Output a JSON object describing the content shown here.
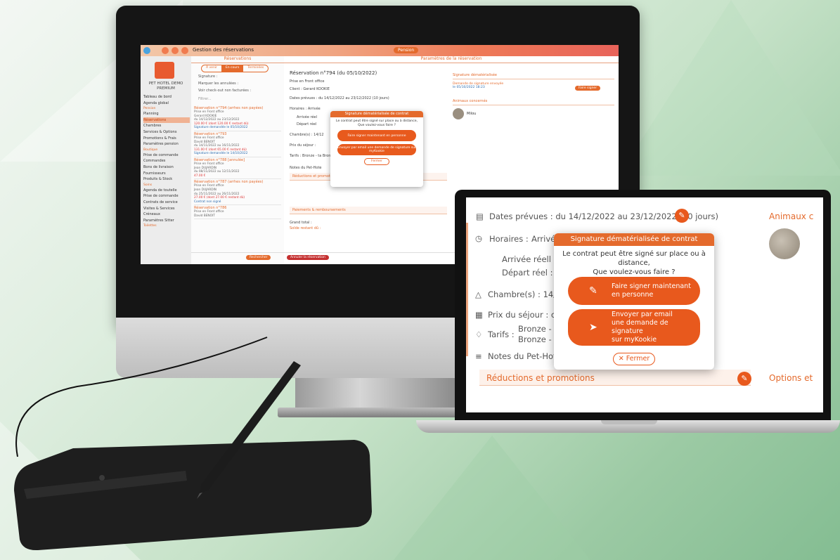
{
  "monitor": {
    "topbar": {
      "title": "Gestion des réservations",
      "pill": "Pension"
    },
    "sidebar": {
      "hotel": "PET HOTEL DEMO PREMIUM",
      "items": [
        {
          "label": "Tableau de bord"
        },
        {
          "label": "Agenda global"
        },
        {
          "label": "Pension",
          "head": true
        },
        {
          "label": "Planning"
        },
        {
          "label": "Réservations",
          "active": true
        },
        {
          "label": "Chambres"
        },
        {
          "label": "Services & Options"
        },
        {
          "label": "Promotions & Frais"
        },
        {
          "label": "Paramètres pension"
        },
        {
          "label": "Boutique",
          "head": true
        },
        {
          "label": "Prise de commande"
        },
        {
          "label": "Commandes"
        },
        {
          "label": "Bons de livraison"
        },
        {
          "label": "Fournisseurs"
        },
        {
          "label": "Produits & Stock"
        },
        {
          "label": "Soins",
          "head": true
        },
        {
          "label": "Agenda de toutelle"
        },
        {
          "label": "Prise de commande"
        },
        {
          "label": "Contrats de service"
        },
        {
          "label": "Visites & Services"
        },
        {
          "label": "Créneaux"
        },
        {
          "label": "Paramètres Sitter"
        },
        {
          "label": "Toilettes",
          "head": true
        }
      ]
    },
    "reservations": {
      "header": "Réservations",
      "tabs": [
        "À venir",
        "En cours",
        "Terminées"
      ],
      "signature_label": "Signature :",
      "marquer": "Marquer les annulées :",
      "voir": "Voir check-out non facturées :",
      "search_placeholder": "Filtrer...",
      "entries": [
        {
          "title": "Réservation n°794 (arrhes non payées)",
          "lines": [
            "Prise en Front office",
            "Gerard KOOKIE",
            "du 14/12/2022 au 23/12/2022",
            "120.00 € (dont 120.00 € restant dû)",
            "Signature demandée le 05/10/2022"
          ]
        },
        {
          "title": "Réservation n°793",
          "lines": [
            "Prise en Front office",
            "David BENOIT",
            "du 14/11/2022 au 16/11/2022",
            "131.00 € (dont 65.00 € restant dû)",
            "Signature demandée le 14/10/2022"
          ]
        },
        {
          "title": "Réservation n°788 [annulée]",
          "lines": [
            "Prise en Front office",
            "Jean DUJARDIN",
            "du 08/11/2022 au 12/11/2022",
            "47.00 €"
          ]
        },
        {
          "title": "Réservation n°787 (arrhes non payées)",
          "lines": [
            "Prise en Front office",
            "Jean DUJARDIN",
            "du 25/11/2022 au 26/11/2022",
            "27.00 € (dont 27.00 € restant dû)",
            "Contrat non signé"
          ]
        },
        {
          "title": "Réservation n°786",
          "lines": [
            "Prise en Front office",
            "David BENOIT"
          ]
        }
      ],
      "search_btn": "Rechercher"
    },
    "detail": {
      "header": "Paramètres de la réservation",
      "title": "Réservation n°794 (du 05/10/2022)",
      "lines": [
        "Prise en Front office",
        "Client : Gerard KOOKIE",
        "Dates prévues : du 14/12/2022 au 23/12/2022 (10 jours)",
        "Horaires : Arrivée",
        "Arrivée réel",
        "Départ réel",
        "Chambre(s) : 14/12",
        "Prix du séjour :",
        "Tarifs : Bronze - ta  Bronze - Ta",
        "Notes du Pet-Hote"
      ],
      "section_reductions": "Réductions et promotions",
      "section_paiements": "Paiements & remboursements",
      "grand_total": "Grand total :",
      "solde": "Solde restant dû :",
      "signature_head": "Signature dématérialisée",
      "signature_req": "Demande de signature envoyée",
      "signature_date": "le 05/10/2022 18:23",
      "signer_btn": "Faire signer",
      "animaux_head": "Animaux concernés",
      "animal": "Milou",
      "cancel_btn": "Annuler la réservation",
      "pdf_btn": "Contrat PDF"
    },
    "dialog": {
      "title": "Signature dématérialisée de contrat",
      "message": "Le contrat peut être signé sur place ou à distance, Que voulez-vous faire ?",
      "btn1": "Faire signer maintenant en personne",
      "btn2": "Envoyer par email une demande de signature sur myKookie",
      "close": "Fermer"
    }
  },
  "laptop": {
    "dates": "Dates prévues : du 14/12/2022 au 23/12/2022 (10 jours)",
    "animaux": "Animaux c",
    "horaires": "Horaires :",
    "arrivee": "Arrivée",
    "arrivee_reel": "Arrivée réell",
    "depart_reel": "Départ réel :",
    "chambre": "Chambre(s) :  14/12,",
    "prix": "Prix du séjour :  ca",
    "tarifs_label": "Tarifs :",
    "tarifs_1": "Bronze - ta",
    "tarifs_2": "Bronze - Ta",
    "notes": "Notes du Pet-Hote",
    "reductions": "Réductions et promotions",
    "options": "Options et",
    "dialog": {
      "title": "Signature dématérialisée de contrat",
      "message_1": "Le contrat peut être signé sur place ou à distance,",
      "message_2": "Que voulez-vous faire ?",
      "btn1_1": "Faire signer maintenant",
      "btn1_2": "en personne",
      "btn2_1": "Envoyer par email",
      "btn2_2": "une demande de signature",
      "btn2_3": "sur myKookie",
      "close": "Fermer"
    }
  },
  "colors": {
    "accent": "#e46a2c",
    "accent_dark": "#e8591d",
    "background": "#c6e2c8"
  }
}
